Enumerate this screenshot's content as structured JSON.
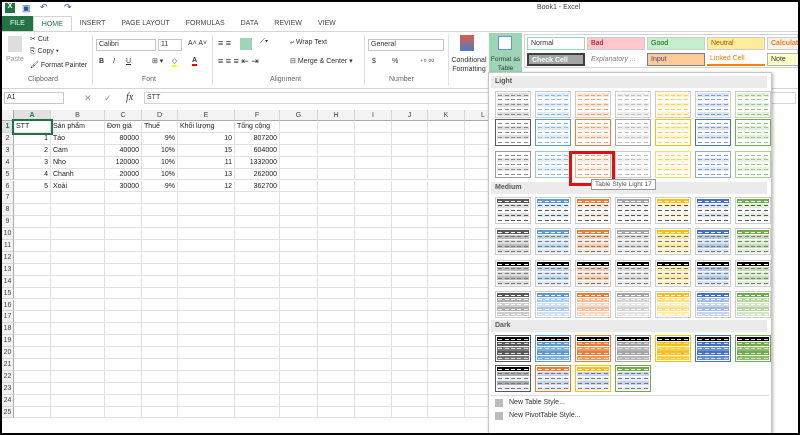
{
  "window": {
    "title": "Book1 - Excel"
  },
  "tabs": [
    "FILE",
    "HOME",
    "INSERT",
    "PAGE LAYOUT",
    "FORMULAS",
    "DATA",
    "REVIEW",
    "VIEW"
  ],
  "ribbon": {
    "clipboard": {
      "paste": "Paste",
      "cut": "Cut",
      "copy": "Copy",
      "format_painter": "Format Painter",
      "label": "Clipboard"
    },
    "font": {
      "name": "Calibri",
      "size": "11",
      "label": "Font",
      "bold": "B",
      "italic": "I",
      "underline": "U"
    },
    "alignment": {
      "wrap": "Wrap Text",
      "merge": "Merge & Center",
      "label": "Alignment"
    },
    "number": {
      "format": "General",
      "currency": "$",
      "percent": "%",
      "label": "Number"
    },
    "styles": {
      "conditional": "Conditional Formatting",
      "format_table": "Format as Table"
    }
  },
  "cell_styles": [
    "Normal",
    "Bad",
    "Good",
    "Neutral",
    "Calculation",
    "Check Cell",
    "Explanatory ...",
    "Input",
    "Linked Cell",
    "Note"
  ],
  "formula_bar": {
    "name_box": "A1",
    "fx": "fx",
    "value": "STT"
  },
  "sheet": {
    "columns": [
      "A",
      "B",
      "C",
      "D",
      "E",
      "F",
      "G",
      "H",
      "I",
      "J",
      "K",
      "L"
    ],
    "rows": [
      [
        "STT",
        "Sản phẩm",
        "Đơn giá",
        "Thuế",
        "Khối lượng",
        "Tổng cộng"
      ],
      [
        "1",
        "Táo",
        "80000",
        "9%",
        "10",
        "807200"
      ],
      [
        "2",
        "Cam",
        "40000",
        "10%",
        "15",
        "604000"
      ],
      [
        "3",
        "Nho",
        "120000",
        "10%",
        "11",
        "1332000"
      ],
      [
        "4",
        "Chanh",
        "20000",
        "10%",
        "13",
        "262000"
      ],
      [
        "5",
        "Xoài",
        "30000",
        "9%",
        "12",
        "362700"
      ]
    ],
    "row_count": 25
  },
  "gallery": {
    "sections": [
      "Light",
      "Medium",
      "Dark"
    ],
    "tooltip": "Table Style Light 17",
    "selected": "Table Style Light 17",
    "palette": [
      "#595959",
      "#5b9bd5",
      "#ed7d31",
      "#a5a5a5",
      "#ffc000",
      "#4472c4",
      "#70ad47"
    ],
    "menu": [
      "New Table Style...",
      "New PivotTable Style..."
    ]
  }
}
